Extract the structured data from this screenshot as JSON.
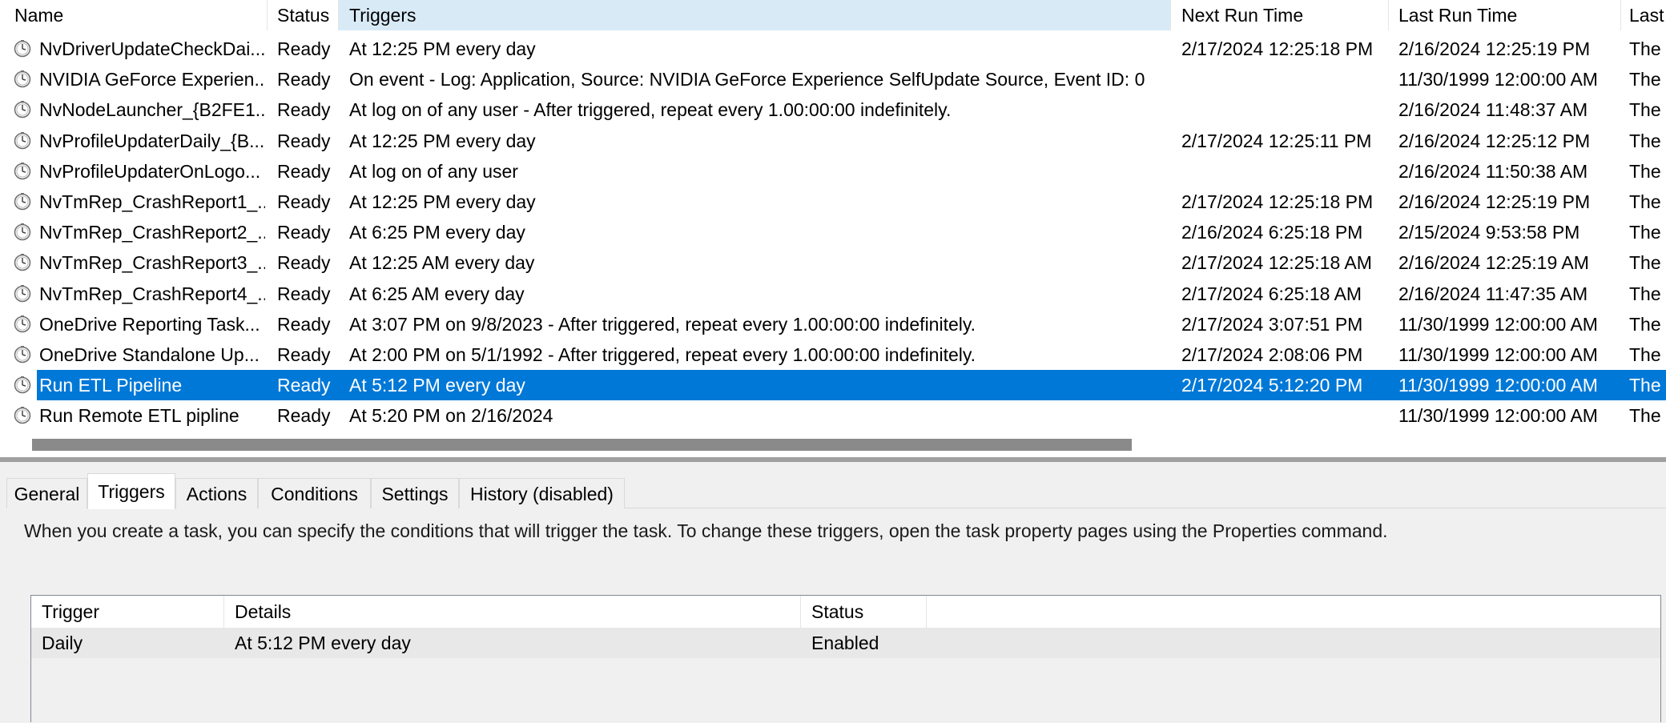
{
  "task_list": {
    "columns": {
      "name": "Name",
      "status": "Status",
      "triggers": "Triggers",
      "next_run": "Next Run Time",
      "last_run": "Last Run Time",
      "last_result": "Last"
    },
    "rows": [
      {
        "name": "NvDriverUpdateCheckDai...",
        "status": "Ready",
        "triggers": "At 12:25 PM every day",
        "next_run": "2/17/2024 12:25:18 PM",
        "last_run": "2/16/2024 12:25:19 PM",
        "last_result": "The"
      },
      {
        "name": "NVIDIA GeForce Experien...",
        "status": "Ready",
        "triggers": "On event - Log: Application, Source: NVIDIA GeForce Experience SelfUpdate Source, Event ID: 0",
        "next_run": "",
        "last_run": "11/30/1999 12:00:00 AM",
        "last_result": "The"
      },
      {
        "name": "NvNodeLauncher_{B2FE1...",
        "status": "Ready",
        "triggers": "At log on of any user - After triggered, repeat every 1.00:00:00 indefinitely.",
        "next_run": "",
        "last_run": "2/16/2024 11:48:37 AM",
        "last_result": "The"
      },
      {
        "name": "NvProfileUpdaterDaily_{B...",
        "status": "Ready",
        "triggers": "At 12:25 PM every day",
        "next_run": "2/17/2024 12:25:11 PM",
        "last_run": "2/16/2024 12:25:12 PM",
        "last_result": "The"
      },
      {
        "name": "NvProfileUpdaterOnLogo...",
        "status": "Ready",
        "triggers": "At log on of any user",
        "next_run": "",
        "last_run": "2/16/2024 11:50:38 AM",
        "last_result": "The"
      },
      {
        "name": "NvTmRep_CrashReport1_...",
        "status": "Ready",
        "triggers": "At 12:25 PM every day",
        "next_run": "2/17/2024 12:25:18 PM",
        "last_run": "2/16/2024 12:25:19 PM",
        "last_result": "The"
      },
      {
        "name": "NvTmRep_CrashReport2_...",
        "status": "Ready",
        "triggers": "At 6:25 PM every day",
        "next_run": "2/16/2024 6:25:18 PM",
        "last_run": "2/15/2024 9:53:58 PM",
        "last_result": "The"
      },
      {
        "name": "NvTmRep_CrashReport3_...",
        "status": "Ready",
        "triggers": "At 12:25 AM every day",
        "next_run": "2/17/2024 12:25:18 AM",
        "last_run": "2/16/2024 12:25:19 AM",
        "last_result": "The"
      },
      {
        "name": "NvTmRep_CrashReport4_...",
        "status": "Ready",
        "triggers": "At 6:25 AM every day",
        "next_run": "2/17/2024 6:25:18 AM",
        "last_run": "2/16/2024 11:47:35 AM",
        "last_result": "The"
      },
      {
        "name": "OneDrive Reporting Task...",
        "status": "Ready",
        "triggers": "At 3:07 PM on 9/8/2023 - After triggered, repeat every 1.00:00:00 indefinitely.",
        "next_run": "2/17/2024 3:07:51 PM",
        "last_run": "11/30/1999 12:00:00 AM",
        "last_result": "The"
      },
      {
        "name": "OneDrive Standalone Up...",
        "status": "Ready",
        "triggers": "At 2:00 PM on 5/1/1992 - After triggered, repeat every 1.00:00:00 indefinitely.",
        "next_run": "2/17/2024 2:08:06 PM",
        "last_run": "11/30/1999 12:00:00 AM",
        "last_result": "The"
      },
      {
        "name": "Run ETL Pipeline",
        "status": "Ready",
        "triggers": "At 5:12 PM every day",
        "next_run": "2/17/2024 5:12:20 PM",
        "last_run": "11/30/1999 12:00:00 AM",
        "last_result": "The"
      },
      {
        "name": "Run Remote ETL pipline",
        "status": "Ready",
        "triggers": "At 5:20 PM on 2/16/2024",
        "next_run": "",
        "last_run": "11/30/1999 12:00:00 AM",
        "last_result": "The"
      }
    ],
    "selected_index": 11,
    "icon": "clock-task-icon"
  },
  "detail": {
    "tabs": [
      "General",
      "Triggers",
      "Actions",
      "Conditions",
      "Settings",
      "History (disabled)"
    ],
    "active_tab": "Triggers",
    "description": "When you create a task, you can specify the conditions that will trigger the task.  To change these triggers, open the task property pages using the Properties command.",
    "triggers_table": {
      "columns": [
        "Trigger",
        "Details",
        "Status"
      ],
      "rows": [
        {
          "trigger": "Daily",
          "details": "At 5:12 PM every day",
          "status": "Enabled"
        }
      ]
    }
  },
  "colors": {
    "selection": "#0078d7",
    "sorted_column_header": "#d9eaf7",
    "window_bg": "#f0f0f0"
  }
}
